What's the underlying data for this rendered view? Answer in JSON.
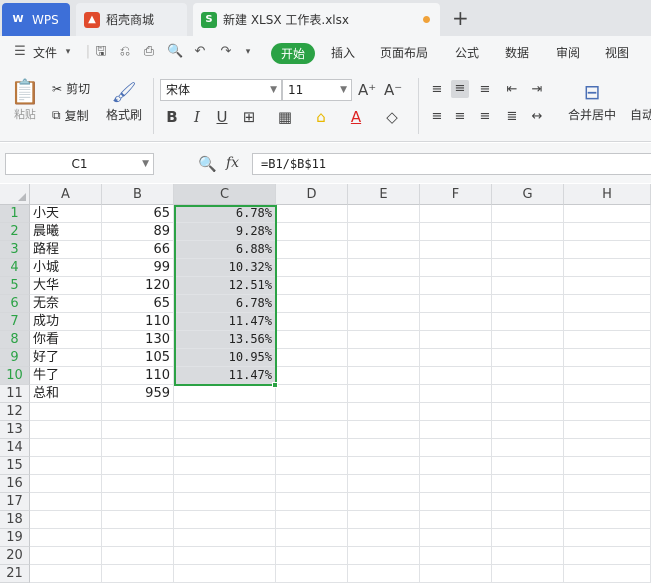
{
  "tabs": {
    "wps": "WPS",
    "daoke": "稻壳商城",
    "file": "新建 XLSX 工作表.xlsx"
  },
  "menu": {
    "file": "文件",
    "start": "开始",
    "insert": "插入",
    "page_layout": "页面布局",
    "formula": "公式",
    "data": "数据",
    "review": "审阅",
    "view": "视图"
  },
  "ribbon": {
    "paste": "粘贴",
    "cut": "剪切",
    "copy": "复制",
    "format_painter": "格式刷",
    "font_name": "宋体",
    "font_size": "11",
    "merge_center": "合并居中",
    "auto": "自动"
  },
  "formula_bar": {
    "name_box": "C1",
    "fx": "fx",
    "formula": "=B1/$B$11"
  },
  "columns": [
    "A",
    "B",
    "C",
    "D",
    "E",
    "F",
    "G",
    "H"
  ],
  "rows": [
    {
      "n": "1",
      "a": "小天",
      "b": "65",
      "c": "6.78%"
    },
    {
      "n": "2",
      "a": "晨曦",
      "b": "89",
      "c": "9.28%"
    },
    {
      "n": "3",
      "a": "路程",
      "b": "66",
      "c": "6.88%"
    },
    {
      "n": "4",
      "a": "小城",
      "b": "99",
      "c": "10.32%"
    },
    {
      "n": "5",
      "a": "大华",
      "b": "120",
      "c": "12.51%"
    },
    {
      "n": "6",
      "a": "无奈",
      "b": "65",
      "c": "6.78%"
    },
    {
      "n": "7",
      "a": "成功",
      "b": "110",
      "c": "11.47%"
    },
    {
      "n": "8",
      "a": "你看",
      "b": "130",
      "c": "13.56%"
    },
    {
      "n": "9",
      "a": "好了",
      "b": "105",
      "c": "10.95%"
    },
    {
      "n": "10",
      "a": "牛了",
      "b": "110",
      "c": "11.47%"
    },
    {
      "n": "11",
      "a": "总和",
      "b": "959",
      "c": ""
    },
    {
      "n": "12",
      "a": "",
      "b": "",
      "c": ""
    },
    {
      "n": "13",
      "a": "",
      "b": "",
      "c": ""
    },
    {
      "n": "14",
      "a": "",
      "b": "",
      "c": ""
    },
    {
      "n": "15",
      "a": "",
      "b": "",
      "c": ""
    },
    {
      "n": "16",
      "a": "",
      "b": "",
      "c": ""
    },
    {
      "n": "17",
      "a": "",
      "b": "",
      "c": ""
    },
    {
      "n": "18",
      "a": "",
      "b": "",
      "c": ""
    },
    {
      "n": "19",
      "a": "",
      "b": "",
      "c": ""
    },
    {
      "n": "20",
      "a": "",
      "b": "",
      "c": ""
    },
    {
      "n": "21",
      "a": "",
      "b": "",
      "c": ""
    }
  ],
  "colors": {
    "accent": "#2ba245",
    "wps_tab": "#3d6fd8",
    "modified_dot": "#f0a23a"
  }
}
